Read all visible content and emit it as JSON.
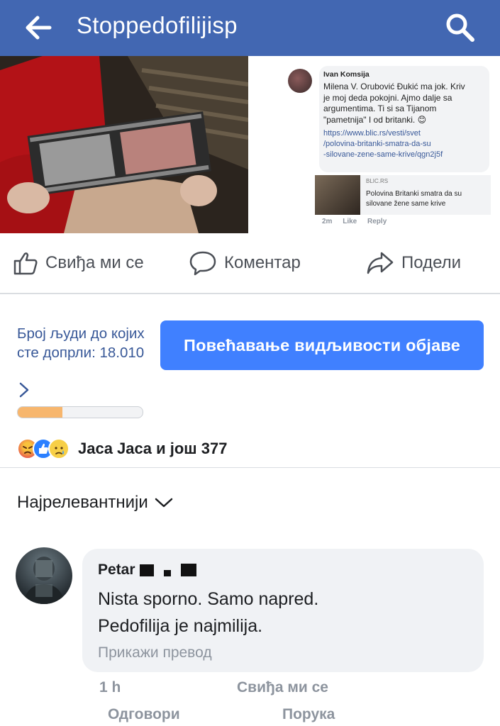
{
  "header": {
    "title": "Stoppedofilijisp",
    "back_icon": "back-arrow-icon",
    "search_icon": "search-icon",
    "bg_color": "#4267b2"
  },
  "screenshot_comment": {
    "author": "Ivan Komsija",
    "text": "Milena V. Orubović Đukić ma jok. Kriv\nje moj deda pokojni. Ajmo dalje sa\nargumentima. Ti si sa Tijanom\n\"pametnija\" I od britanki. 😊",
    "link": "https://www.blic.rs/vesti/svet\n/polovina-britanki-smatra-da-su\n-silovane-zene-same-krive/qgn2j5f",
    "link_source": "BLIC.RS",
    "link_title": "Polovina Britanki smatra da su silovane žene same krive",
    "meta": "2m Like Reply"
  },
  "actions": {
    "like": "Свиђа ми се",
    "comment": "Коментар",
    "share": "Подели"
  },
  "reach": {
    "text": "Број људи до којих сте допрли: 18.010",
    "progress_fraction": 0.36,
    "progress_color": "#f7b66d"
  },
  "boost_button": "Повећавање видљивости објаве",
  "reactions_summary": "Jaca Jaca и још 377",
  "sort_label": "Најрелевантнији",
  "comment": {
    "author": "Petar",
    "text": "Nista sporno. Samo napred.\nPedofilija je najmilija.",
    "translate": "Прикажи превод",
    "time": "1 h",
    "like": "Свиђа ми се",
    "reply": "Одговори",
    "message": "Порука"
  }
}
